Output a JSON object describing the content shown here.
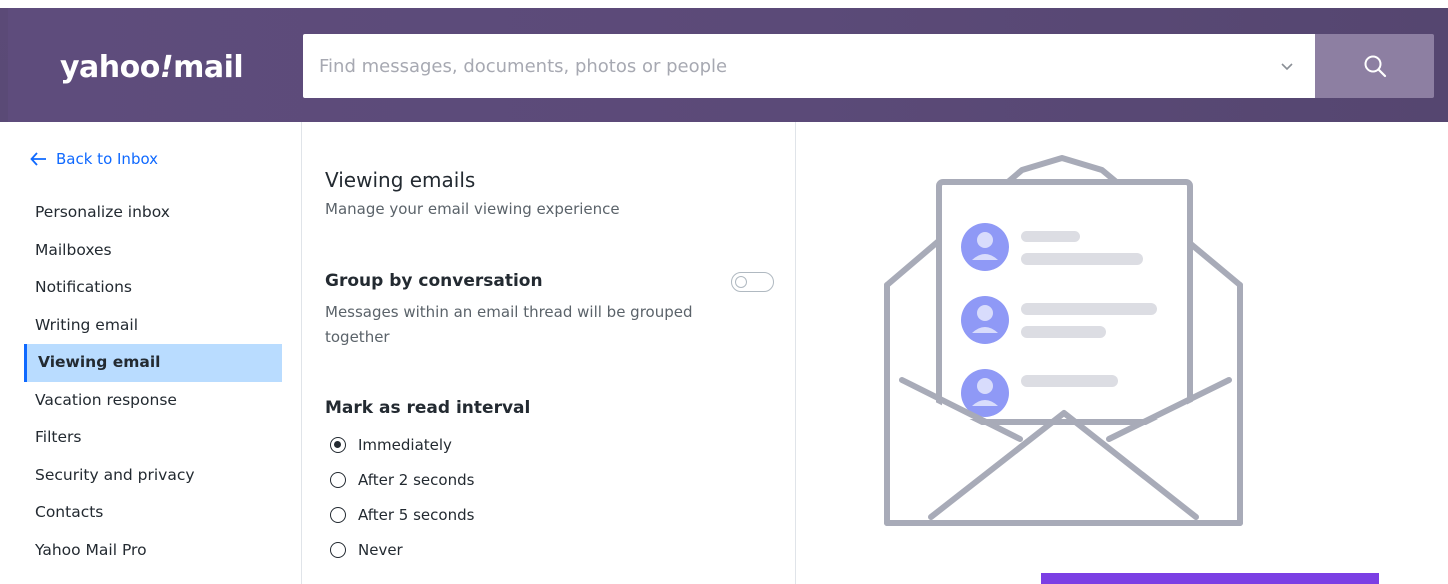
{
  "header": {
    "logo_text": "yahoo",
    "logo_bang": "!",
    "logo_mail": "mail",
    "search_placeholder": "Find messages, documents, photos or people",
    "search_icon": "search-icon",
    "dropdown_icon": "chevron-down-icon"
  },
  "sidebar": {
    "back_label": "Back to Inbox",
    "items": [
      {
        "label": "Personalize inbox",
        "active": false
      },
      {
        "label": "Mailboxes",
        "active": false
      },
      {
        "label": "Notifications",
        "active": false
      },
      {
        "label": "Writing email",
        "active": false
      },
      {
        "label": "Viewing email",
        "active": true
      },
      {
        "label": "Vacation response",
        "active": false
      },
      {
        "label": "Filters",
        "active": false
      },
      {
        "label": "Security and privacy",
        "active": false
      },
      {
        "label": "Contacts",
        "active": false
      },
      {
        "label": "Yahoo Mail Pro",
        "active": false
      }
    ]
  },
  "settings": {
    "title": "Viewing emails",
    "subtitle": "Manage your email viewing experience",
    "group_by": {
      "title": "Group by conversation",
      "description": "Messages within an email thread will be grouped together",
      "enabled": false
    },
    "mark_as_read": {
      "title": "Mark as read interval",
      "options": [
        {
          "label": "Immediately",
          "selected": true
        },
        {
          "label": "After 2 seconds",
          "selected": false
        },
        {
          "label": "After 5 seconds",
          "selected": false
        },
        {
          "label": "Never",
          "selected": false
        }
      ]
    }
  },
  "colors": {
    "header_bg": "#5b4a78",
    "search_button_bg": "#8d7fa2",
    "link": "#0f69ff",
    "active_item_bg": "#b9dcff",
    "illustration_stroke": "#a8abb8",
    "avatar": "#8f99f6"
  }
}
